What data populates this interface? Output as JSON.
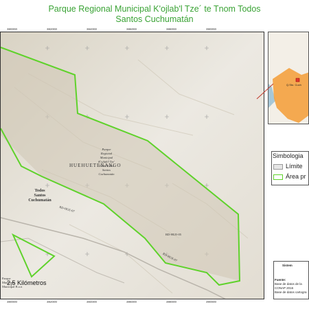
{
  "title": {
    "line1": "Parque Regional Municipal K'ojlab'l Tze´ te Tnom Todos",
    "line2": "Santos Cuchumatán"
  },
  "grid": {
    "x_labels": [
      "380000",
      "382000",
      "384000",
      "386000",
      "388000",
      "390000"
    ],
    "y_labels": [
      "1724000",
      "1722000",
      "1720000",
      "1718000",
      "1716000",
      "1714000",
      "1712000"
    ]
  },
  "map_labels": {
    "department": "HUEHUETENANGO",
    "town_line1": "Todos",
    "town_line2": "Santos",
    "town_line3": "Cuchumatán",
    "park_lines": [
      "Parque",
      "Regional",
      "Municipal",
      "K'ojlab'l Tze'",
      "Tnom Todos",
      "Santos",
      "Cuchumatán"
    ],
    "road1": "RD-HUE-07",
    "road2": "RD-HUE-07",
    "road3": "RD-HUE-05",
    "small_park_line1": "Parque",
    "small_park_line2": "Municipal",
    "small_park_line3": "Municipal B.o.n"
  },
  "scale_bar": {
    "label": "2,5 Kilómetros"
  },
  "legend": {
    "title": "Simbologia",
    "items": [
      {
        "label": "Límite",
        "color": "#e6e6e6"
      },
      {
        "label": "Área pr",
        "color": "#5fd22b"
      }
    ]
  },
  "source_box": {
    "heading": "Sistem",
    "fuente_label": "Fuente:",
    "line1": "Base de datos de la",
    "line2": "CONAP 2016",
    "line3": "Base de datos cartogra"
  },
  "inset_labels": {
    "place": "Q.Sto. Cuch"
  },
  "colors": {
    "title": "#3aa335",
    "boundary": "#5fd22b",
    "relief": "#e9e6e0",
    "park_fill": "#cfc6b4",
    "inset_land": "#f3efe7",
    "inset_department": "#f39c35",
    "inset_sea": "#a7c8d8"
  }
}
